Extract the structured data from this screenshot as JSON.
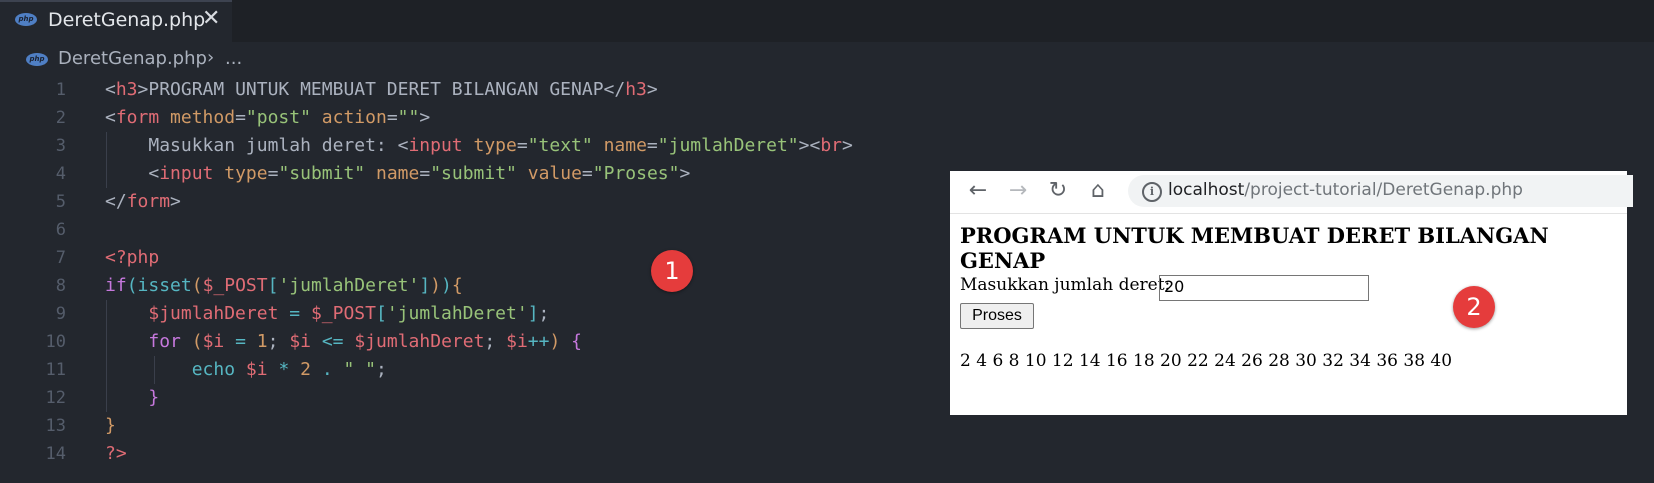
{
  "tab": {
    "icon": "php-file-icon",
    "icon_label": "php",
    "name": "DeretGenap.php",
    "close": "✕"
  },
  "breadcrumb": {
    "file": "DeretGenap.php",
    "separator": "›",
    "more": "..."
  },
  "code_lines": [
    "1",
    "2",
    "3",
    "4",
    "5",
    "6",
    "7",
    "8",
    "9",
    "10",
    "11",
    "12",
    "13",
    "14"
  ],
  "badges": {
    "editor": "1",
    "browser": "2"
  },
  "browser": {
    "url_host": "localhost",
    "url_path": "/project-tutorial/DeretGenap.php",
    "page_title": "PROGRAM UNTUK MEMBUAT DERET BILANGAN GENAP",
    "label": "Masukkan jumlah deret:",
    "input_value": "20",
    "button_label": "Proses",
    "result": "2 4 6 8 10 12 14 16 18 20 22 24 26 28 30 32 34 36 38 40"
  },
  "colors": {
    "editor_bg": "#23272e",
    "badge": "#e53c3c",
    "tag": "#e06c75",
    "string": "#98c379",
    "keyword": "#c678dd"
  }
}
